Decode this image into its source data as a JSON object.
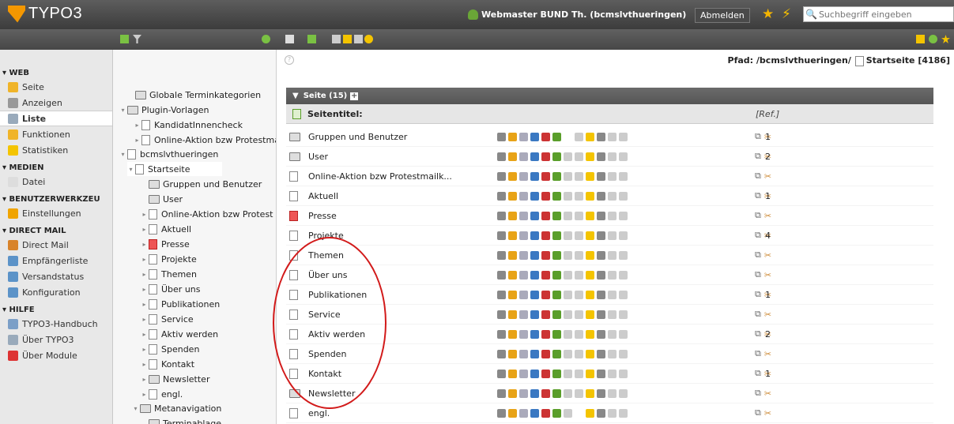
{
  "app": {
    "logo": "TYPO3"
  },
  "topbar": {
    "user": "Webmaster BUND Th. (bcmslvthueringen)",
    "logout": "Abmelden",
    "search_placeholder": "Suchbegriff eingeben"
  },
  "colors": {
    "accent": "#f49700",
    "topbar": "#444444",
    "circle": "#d21a1a"
  },
  "modules": [
    {
      "group": "WEB",
      "items": [
        {
          "label": "Seite",
          "icon": "pencil-page-icon"
        },
        {
          "label": "Anzeigen",
          "icon": "eye-icon"
        },
        {
          "label": "Liste",
          "icon": "list-icon",
          "active": true
        }
      ]
    },
    {
      "group": "",
      "items": [
        {
          "label": "Funktionen",
          "icon": "wand-icon"
        },
        {
          "label": "Statistiken",
          "icon": "pi-icon"
        }
      ]
    },
    {
      "group": "MEDIEN",
      "items": [
        {
          "label": "Datei",
          "icon": "folder-icon"
        }
      ]
    },
    {
      "group": "BENUTZERWERKZEU",
      "items": [
        {
          "label": "Einstellungen",
          "icon": "user-settings-icon"
        }
      ]
    },
    {
      "group": "DIRECT MAIL",
      "items": [
        {
          "label": "Direct Mail",
          "icon": "mail-icon"
        },
        {
          "label": "Empfängerliste",
          "icon": "recipient-icon"
        },
        {
          "label": "Versandstatus",
          "icon": "status-icon"
        },
        {
          "label": "Konfiguration",
          "icon": "config-icon"
        }
      ]
    },
    {
      "group": "HILFE",
      "items": [
        {
          "label": "TYPO3-Handbuch",
          "icon": "manual-icon"
        },
        {
          "label": "Über TYPO3",
          "icon": "about-icon"
        },
        {
          "label": "Über Module",
          "icon": "modules-icon"
        }
      ]
    }
  ],
  "tree": [
    "Globale Terminkategorien",
    "Plugin-Vorlagen",
    "KandidatInnencheck",
    "Online-Aktion bzw Protestma",
    "bcmslvthueringen",
    "Startseite",
    "Gruppen und Benutzer",
    "User",
    "Online-Aktion bzw Protest",
    "Aktuell",
    "Presse",
    "Projekte",
    "Themen",
    "Über uns",
    "Publikationen",
    "Service",
    "Aktiv werden",
    "Spenden",
    "Kontakt",
    "Newsletter",
    "engl.",
    "Metanavigation",
    "Terminablage"
  ],
  "main": {
    "path_label": "Pfad:",
    "path_value": "/bcmslvthueringen/",
    "path_page": "Startseite [4186]",
    "section": "Seite (15)",
    "col_title": "Seitentitel:",
    "col_ref": "[Ref.]",
    "rows": [
      {
        "title": "Gruppen und Benutzer",
        "ref": "1",
        "icon": "folder-icon"
      },
      {
        "title": "User",
        "ref": "2",
        "icon": "folder-icon"
      },
      {
        "title": "Online-Aktion bzw Protestmailk...",
        "ref": "",
        "icon": "page-icon"
      },
      {
        "title": "Aktuell",
        "ref": "1",
        "icon": "page-icon"
      },
      {
        "title": "Presse",
        "ref": "",
        "icon": "page-red-icon"
      },
      {
        "title": "Projekte",
        "ref": "4",
        "icon": "page-icon"
      },
      {
        "title": "Themen",
        "ref": "",
        "icon": "page-icon"
      },
      {
        "title": "Über uns",
        "ref": "",
        "icon": "page-icon"
      },
      {
        "title": "Publikationen",
        "ref": "1",
        "icon": "page-icon"
      },
      {
        "title": "Service",
        "ref": "",
        "icon": "page-icon"
      },
      {
        "title": "Aktiv werden",
        "ref": "2",
        "icon": "page-icon"
      },
      {
        "title": "Spenden",
        "ref": "",
        "icon": "page-icon"
      },
      {
        "title": "Kontakt",
        "ref": "1",
        "icon": "page-icon"
      },
      {
        "title": "Newsletter",
        "ref": "",
        "icon": "folder-icon"
      },
      {
        "title": "engl.",
        "ref": "",
        "icon": "page-icon"
      }
    ]
  }
}
